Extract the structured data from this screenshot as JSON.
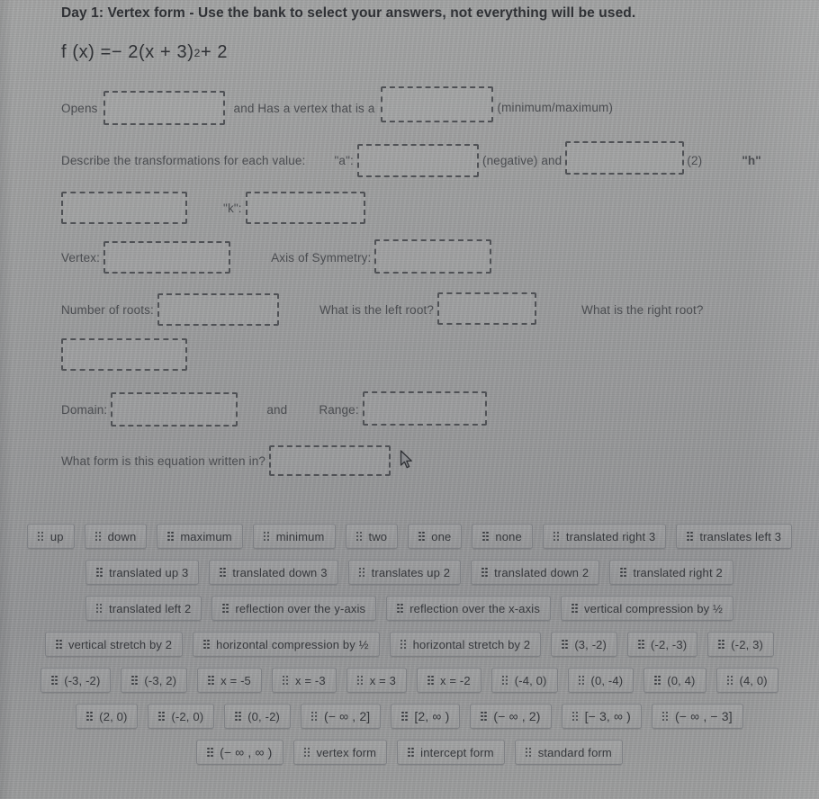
{
  "worksheet": {
    "title": "Day 1: Vertex form - Use the bank to select your answers, not everything will be used.",
    "equation_prefix": "f (x) = ",
    "equation_body": "− 2(x + 3)",
    "equation_exponent": "2",
    "equation_suffix": " + 2"
  },
  "prompts": {
    "opens": "Opens",
    "vertex_that_is_a": "and Has a vertex that is a",
    "min_max": "(minimum/maximum)",
    "describe_transformations": "Describe the transformations for each value:",
    "a_label": "\"a\":",
    "negative_and": "(negative) and",
    "two_paren": "(2)",
    "h_label": "\"h\"",
    "k_label": "\"k\":",
    "vertex": "Vertex:",
    "axis_of_symmetry": "Axis of Symmetry:",
    "number_of_roots": "Number of roots:",
    "left_root": "What is the left root?",
    "right_root": "What is the right root?",
    "domain": "Domain:",
    "and": "and",
    "range": "Range:",
    "what_form": "What form is this equation written in?"
  },
  "answers": {
    "opens": "",
    "vertex_type": "",
    "a_value": "",
    "h_value": "",
    "h_value_2": "",
    "k_value": "",
    "vertex": "",
    "axis_of_symmetry": "",
    "number_of_roots": "",
    "left_root": "",
    "right_root": "",
    "domain": "",
    "range": "",
    "form": ""
  },
  "bank": {
    "grip_icon": "drag-handle-icon",
    "rows": [
      [
        {
          "label": "up"
        },
        {
          "label": "down"
        },
        {
          "label": "maximum"
        },
        {
          "label": "minimum"
        },
        {
          "label": "two"
        },
        {
          "label": "one"
        },
        {
          "label": "none"
        },
        {
          "label": "translated right 3"
        },
        {
          "label": "translates left 3"
        }
      ],
      [
        {
          "label": "translated up 3"
        },
        {
          "label": "translated down 3"
        },
        {
          "label": "translates up 2"
        },
        {
          "label": "translated down 2"
        },
        {
          "label": "translated right 2"
        }
      ],
      [
        {
          "label": "translated left 2"
        },
        {
          "label": "reflection over the y-axis"
        },
        {
          "label": "reflection over the x-axis"
        },
        {
          "label": "vertical compression by  ½"
        }
      ],
      [
        {
          "label": "vertical stretch by 2"
        },
        {
          "label": "horizontal compression by ½"
        },
        {
          "label": "horizontal stretch by 2"
        },
        {
          "label": "(3, -2)"
        },
        {
          "label": "(-2, -3)"
        },
        {
          "label": "(-2, 3)"
        }
      ],
      [
        {
          "label": "(-3, -2)"
        },
        {
          "label": "(-3, 2)"
        },
        {
          "label": "x = -5"
        },
        {
          "label": "x = -3"
        },
        {
          "label": "x = 3"
        },
        {
          "label": "x = -2"
        },
        {
          "label": "(-4, 0)"
        },
        {
          "label": "(0, -4)"
        },
        {
          "label": "(0, 4)"
        },
        {
          "label": "(4, 0)"
        }
      ],
      [
        {
          "label": "(2, 0)"
        },
        {
          "label": "(-2, 0)"
        },
        {
          "label": "(0, -2)"
        },
        {
          "label": "(− ∞ , 2]"
        },
        {
          "label": "[2, ∞ )"
        },
        {
          "label": "(− ∞ , 2)"
        },
        {
          "label": "[− 3, ∞ )"
        },
        {
          "label": "(− ∞ ,  − 3]"
        }
      ],
      [
        {
          "label": "(− ∞ ,  ∞ )"
        },
        {
          "label": "vertex form"
        },
        {
          "label": "intercept form"
        },
        {
          "label": "standard form"
        }
      ]
    ]
  },
  "colors": {
    "page_background": "#9b9c9c",
    "text": "#3a3c40",
    "blank_border": "#4f5155",
    "chip_border": "#7e8084"
  }
}
